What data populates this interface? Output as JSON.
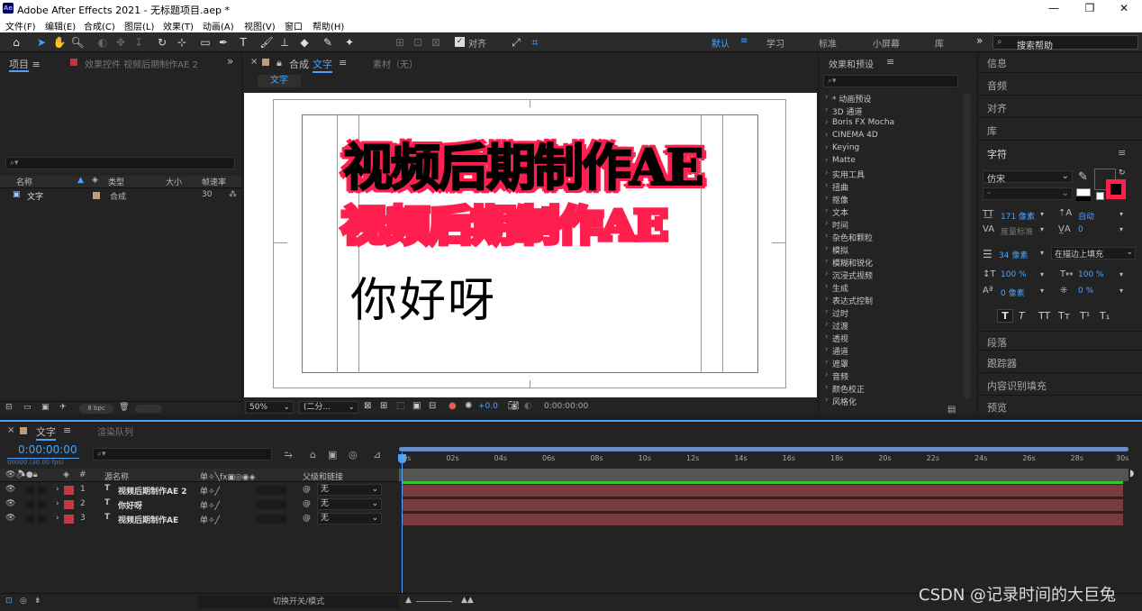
{
  "app": {
    "title": "Adobe After Effects 2021 - 无标题项目.aep *",
    "logo_text": "Ae",
    "window_controls": [
      "—",
      "❐",
      "✕"
    ]
  },
  "menu": [
    "文件(F)",
    "编辑(E)",
    "合成(C)",
    "图层(L)",
    "效果(T)",
    "动画(A)",
    "视图(V)",
    "窗口",
    "帮助(H)"
  ],
  "toolbar": {
    "align_label": "对齐",
    "workspaces": [
      "默认",
      "学习",
      "标准",
      "小屏幕",
      "库"
    ],
    "active_workspace": "默认",
    "more": "»",
    "search_placeholder": "搜索帮助"
  },
  "project_panel": {
    "tab_project": "项目",
    "tab_effects": "效果控件 视频后期制作AE 2",
    "more": "»",
    "columns": [
      "名称",
      "类型",
      "大小",
      "帧速率"
    ],
    "items": [
      {
        "name": "文字",
        "type": "合成",
        "size": "",
        "fps": "30"
      }
    ],
    "bpc": "8 bpc"
  },
  "comp_panel": {
    "tab_close": "×",
    "tab_label_prefix": "合成",
    "tab_comp_name": "文字",
    "tab_footage": "素材（无）",
    "sub_tab": "文字",
    "text_line1": "视频后期制作AE",
    "text_line2": "视频后期制作AE",
    "text_line3": "你好呀",
    "zoom": "50%",
    "resolution": "(二分...",
    "exposure": "+0.0",
    "timecode": "0:00:00:00"
  },
  "effects_panel": {
    "title": "效果和预设",
    "items": [
      "* 动画预设",
      "3D 通道",
      "Boris FX Mocha",
      "CINEMA 4D",
      "Keying",
      "Matte",
      "实用工具",
      "扭曲",
      "抠像",
      "文本",
      "时间",
      "杂色和颗粒",
      "模拟",
      "模糊和锐化",
      "沉浸式视频",
      "生成",
      "表达式控制",
      "过时",
      "过渡",
      "透视",
      "通道",
      "遮罩",
      "音频",
      "颜色校正",
      "风格化"
    ]
  },
  "right_panels": {
    "info": "信息",
    "audio": "音频",
    "align": "对齐",
    "library": "库",
    "character": "字符",
    "paragraph": "段落",
    "tracker": "跟踪器",
    "content_aware": "内容识别填充",
    "preview": "预览"
  },
  "character": {
    "font": "仿宋",
    "style": "-",
    "size": "171 像素",
    "leading": "自动",
    "kerning": "度量标准",
    "tracking": "0",
    "stroke_width": "34 像素",
    "stroke_mode": "在描边上填充",
    "vscale": "100 %",
    "hscale": "100 %",
    "baseline": "0 像素",
    "tsume": "0 %",
    "styles": [
      "T",
      "T",
      "TT",
      "Tт",
      "T¹",
      "T₁"
    ],
    "fill_color": "#000000",
    "stroke_color": "#ff1f4e"
  },
  "timeline": {
    "tab_comp": "文字",
    "tab_render": "渲染队列",
    "timecode": "0:00:00:00",
    "fps_note": "00000 (30.00 fps)",
    "col_source": "源名称",
    "col_parent": "父级和链接",
    "ruler": [
      "0s",
      "02s",
      "04s",
      "06s",
      "08s",
      "10s",
      "12s",
      "14s",
      "16s",
      "18s",
      "20s",
      "22s",
      "24s",
      "26s",
      "28s",
      "30s"
    ],
    "layers": [
      {
        "num": "1",
        "name": "视频后期制作AE 2",
        "parent": "无"
      },
      {
        "num": "2",
        "name": "你好呀",
        "parent": "无"
      },
      {
        "num": "3",
        "name": "视频后期制作AE",
        "parent": "无"
      }
    ],
    "toggle_label": "切换开关/模式",
    "layer_color": "#c0393f"
  },
  "watermark": "CSDN @记录时间的大巨兔"
}
